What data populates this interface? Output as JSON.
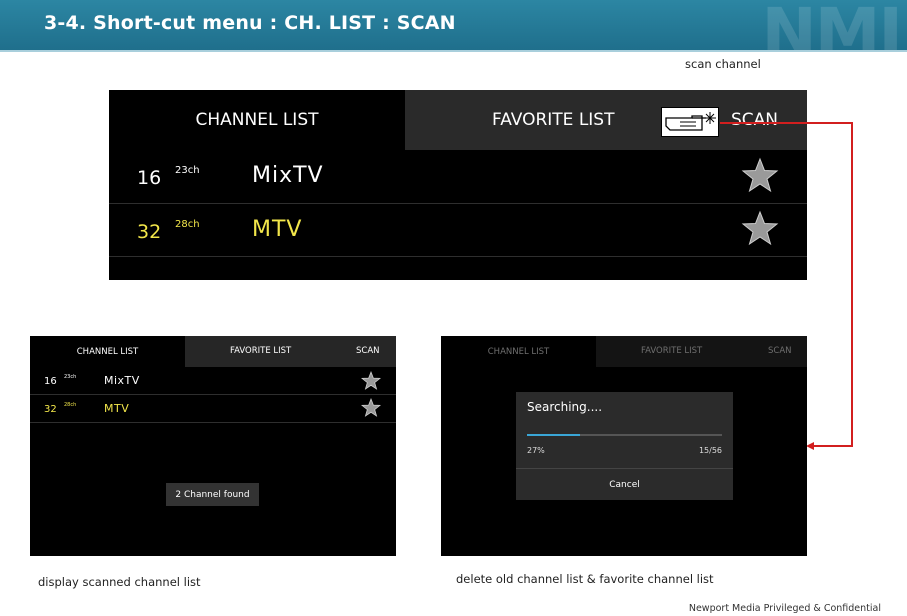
{
  "header": {
    "title": "3-4. Short-cut menu : CH. LIST : SCAN",
    "logo_text": "NMI"
  },
  "captions": {
    "scan_channel": "scan channel",
    "display_list": "display scanned channel list",
    "delete_list": "delete old channel list & favorite channel list"
  },
  "tabs": {
    "channel_list": "CHANNEL LIST",
    "favorite_list": "FAVORITE LIST",
    "scan": "SCAN"
  },
  "channels": [
    {
      "number": "16",
      "rf": "23ch",
      "name": "MixTV",
      "color": "#ffffff"
    },
    {
      "number": "32",
      "rf": "28ch",
      "name": "MTV",
      "color": "#f2e64a"
    }
  ],
  "toast": {
    "text": "2 Channel found"
  },
  "scan_dialog": {
    "title": "Searching....",
    "percent_label": "27%",
    "progress": 0.27,
    "count_label": "15/56",
    "cancel_label": "Cancel"
  },
  "footer": {
    "text": "Newport Media Privileged & Confidential"
  },
  "colors": {
    "header": "#2478956",
    "arrow": "#d21f1f",
    "highlight_channel": "#f2e64a",
    "progress": "#3aa6d6"
  },
  "icons": {
    "pointer": "pointing-hand-icon",
    "favorite": "star-icon"
  }
}
